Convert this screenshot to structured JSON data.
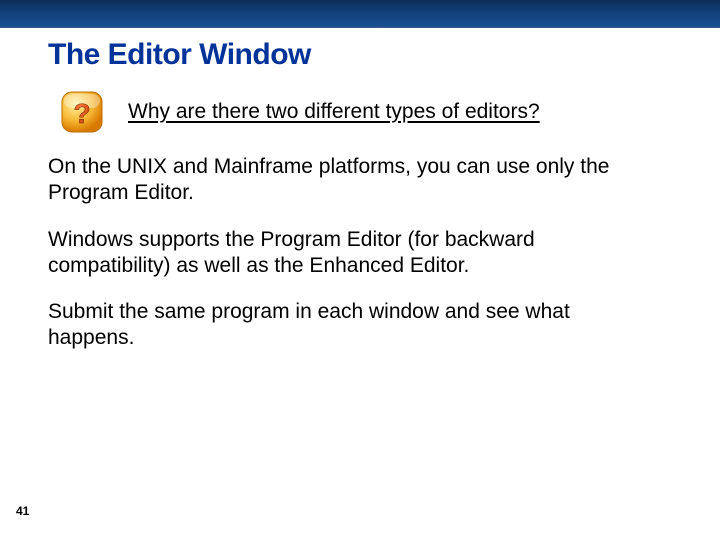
{
  "title": "The Editor Window",
  "question": "Why are there two different types of editors?",
  "paragraphs": {
    "p1": "On the UNIX and Mainframe platforms, you can use only the Program Editor.",
    "p2": "Windows supports the Program Editor (for backward compatibility) as well as the Enhanced Editor.",
    "p3": "Submit the same program in each window and see what happens."
  },
  "page_number": "41",
  "icon_name": "question-icon"
}
